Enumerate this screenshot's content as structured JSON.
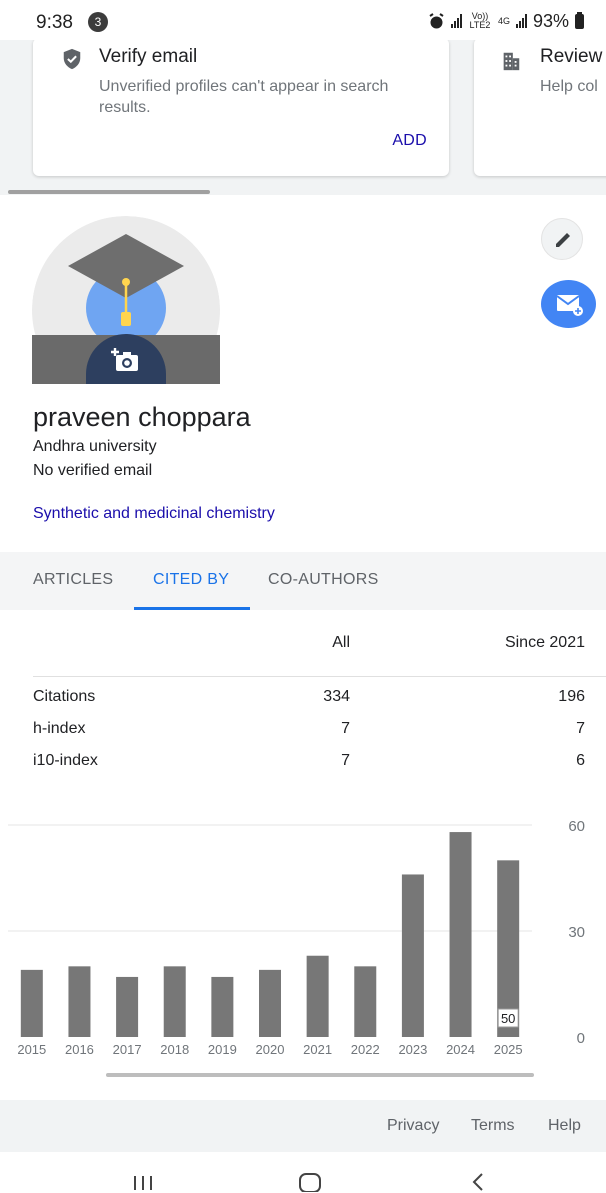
{
  "status_bar": {
    "time": "9:38",
    "notification_count": "3",
    "volte_label": "Vo)) LTE2",
    "network_label": "4G",
    "battery": "93%"
  },
  "cards": [
    {
      "icon": "shield-check-icon",
      "title": "Verify email",
      "subtitle": "Unverified profiles can't appear in search results.",
      "action": "ADD"
    },
    {
      "icon": "building-icon",
      "title": "Review",
      "subtitle": "Help col"
    }
  ],
  "profile": {
    "name": "praveen choppara",
    "affiliation": "Andhra university",
    "email_status": "No verified email",
    "interest": "Synthetic and medicinal chemistry"
  },
  "tabs": [
    {
      "label": "ARTICLES",
      "active": false
    },
    {
      "label": "CITED BY",
      "active": true
    },
    {
      "label": "CO-AUTHORS",
      "active": false
    }
  ],
  "stats": {
    "headers": {
      "all": "All",
      "since": "Since 2021"
    },
    "rows": [
      {
        "label": "Citations",
        "all": "334",
        "since": "196"
      },
      {
        "label": "h-index",
        "all": "7",
        "since": "7"
      },
      {
        "label": "i10-index",
        "all": "7",
        "since": "6"
      }
    ]
  },
  "chart_data": {
    "type": "bar",
    "categories": [
      "2015",
      "2016",
      "2017",
      "2018",
      "2019",
      "2020",
      "2021",
      "2022",
      "2023",
      "2024",
      "2025"
    ],
    "values": [
      19,
      20,
      17,
      20,
      17,
      19,
      23,
      20,
      46,
      58,
      50
    ],
    "value_label": {
      "index": 10,
      "text": "50"
    },
    "yticks": [
      "60",
      "30",
      "0"
    ],
    "ylim": [
      0,
      60
    ],
    "bar_color": "#777777",
    "grid": true
  },
  "footer": {
    "privacy": "Privacy",
    "terms": "Terms",
    "help": "Help"
  },
  "colors": {
    "accent": "#1a73e8",
    "link": "#1a0dab",
    "fab": "#4285f4"
  }
}
